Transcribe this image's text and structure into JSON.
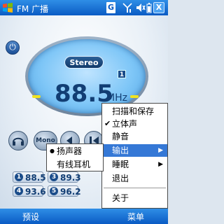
{
  "titlebar": {
    "title": "FM 广播",
    "g_label": "G",
    "close_label": "X",
    "icons": [
      "windows-logo",
      "signal-icon",
      "speaker-icon",
      "battery-icon"
    ]
  },
  "display": {
    "stereo": "Stereo",
    "preset_badge": "1",
    "frequency": "88.5",
    "unit": "MHz"
  },
  "controls": {
    "mono": "Mono",
    "icons": [
      "headphone-icon",
      "prev-icon",
      "skip-back-icon"
    ]
  },
  "presets": [
    {
      "num": "1",
      "freq": "88.5"
    },
    {
      "num": "3",
      "freq": "89.3"
    },
    {
      "num": "4",
      "freq": "93.6"
    },
    {
      "num": "5",
      "freq": "96.2"
    }
  ],
  "menu": {
    "items": [
      {
        "label": "扫描和保存",
        "check": ""
      },
      {
        "label": "立体声",
        "check": "✔"
      },
      {
        "label": "静音",
        "check": ""
      },
      {
        "label": "输出",
        "check": "",
        "arrow": "▶"
      },
      {
        "label": "睡眠",
        "check": "",
        "arrow": "▶"
      },
      {
        "label": "退出",
        "check": ""
      },
      {
        "label": "关于",
        "check": ""
      }
    ]
  },
  "submenu": {
    "items": [
      {
        "label": "扬声器",
        "check": "●"
      },
      {
        "label": "有线耳机",
        "check": ""
      }
    ]
  },
  "softkeys": {
    "left": "预设",
    "right": "菜单"
  },
  "colors": {
    "titlebar": "#0a5bc4",
    "display": "#7ec6f7",
    "highlight": "#3578d6"
  }
}
